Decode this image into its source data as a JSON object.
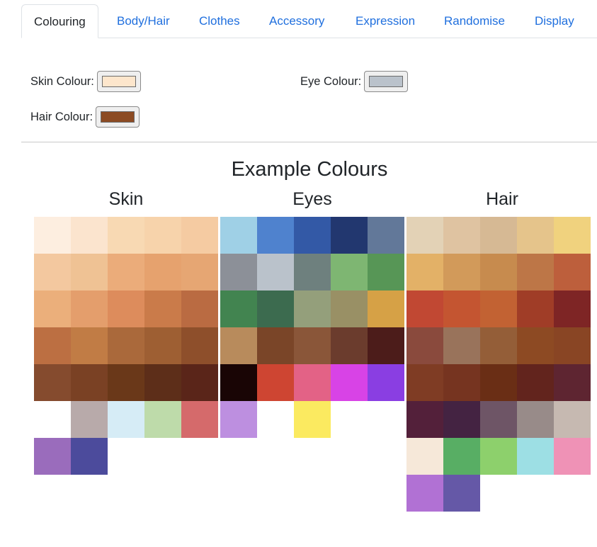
{
  "tabs": [
    {
      "label": "Colouring",
      "active": true
    },
    {
      "label": "Body/Hair",
      "active": false
    },
    {
      "label": "Clothes",
      "active": false
    },
    {
      "label": "Accessory",
      "active": false
    },
    {
      "label": "Expression",
      "active": false
    },
    {
      "label": "Randomise",
      "active": false
    },
    {
      "label": "Display",
      "active": false
    }
  ],
  "fields": {
    "skin": {
      "label": "Skin Colour:",
      "value": "#fde6cc"
    },
    "eye": {
      "label": "Eye Colour:",
      "value": "#bac2cb"
    },
    "hair": {
      "label": "Hair Colour:",
      "value": "#8c4b23"
    }
  },
  "examples": {
    "title": "Example Colours",
    "skin": {
      "title": "Skin",
      "colors": [
        "#fdeee0",
        "#fbe4ce",
        "#f8d9b3",
        "#f7d3ab",
        "#f5cba2",
        "#f3c89f",
        "#efc294",
        "#ebac7a",
        "#e6a26e",
        "#e6a673",
        "#ebaf7b",
        "#e49e6c",
        "#dd8c5c",
        "#ca7b4a",
        "#ba6b42",
        "#bc6f42",
        "#c17c45",
        "#aa693b",
        "#9e5f33",
        "#8e4f2b",
        "#854b2e",
        "#7a4124",
        "#6a3819",
        "#5d2e19",
        "#5a2519",
        "#ffffff",
        "#b8aaaa",
        "#d6ecf6",
        "#bedbaa",
        "#d56a6b",
        "#9a6cbc",
        "#4c4b9c"
      ]
    },
    "eyes": {
      "title": "Eyes",
      "colors": [
        "#9fd0e6",
        "#4f82ce",
        "#3359a6",
        "#22376f",
        "#627899",
        "#8c9098",
        "#bac2cb",
        "#6e807e",
        "#7eb672",
        "#579656",
        "#428450",
        "#3c6b4f",
        "#949f7b",
        "#999065",
        "#d6a146",
        "#b88b5c",
        "#7a4528",
        "#8a5639",
        "#6b3c2d",
        "#4c1c1a",
        "#190505",
        "#ce4532",
        "#e36286",
        "#d843e6",
        "#8a3ee2",
        "#bd8fe0",
        "#ffffff",
        "#fbea60"
      ]
    },
    "hair": {
      "title": "Hair",
      "colors": [
        "#e3d2b6",
        "#dfc3a1",
        "#d6b994",
        "#e5c48b",
        "#f0d27e",
        "#e3b167",
        "#d29a5a",
        "#c78b4e",
        "#bd7647",
        "#bd5f3c",
        "#c14833",
        "#c45531",
        "#c26233",
        "#a03d27",
        "#7e2525",
        "#8a4a3d",
        "#99735b",
        "#945e38",
        "#8d4a23",
        "#894524",
        "#7f3c24",
        "#763420",
        "#6a2e15",
        "#62241d",
        "#5e2531",
        "#53203a",
        "#442342",
        "#6e5566",
        "#988b89",
        "#c6b9b1",
        "#f6e8d9",
        "#58ae64",
        "#8dd06c",
        "#9ddfe4",
        "#ef92b6",
        "#b171d4",
        "#6558a7"
      ]
    }
  }
}
